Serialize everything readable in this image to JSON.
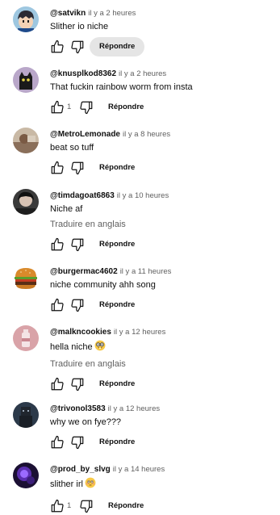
{
  "comments": [
    {
      "author": "@satvikn",
      "time": "il y a 2 heures",
      "text": "Slither io niche",
      "like_count": "",
      "reply_label": "Répondre",
      "avatar_icon": "anime-boy-avatar"
    },
    {
      "author": "@knusplkod8362",
      "time": "il y a 2 heures",
      "text": "That fuckin rainbow worm from insta",
      "like_count": "1",
      "reply_label": "Répondre",
      "avatar_icon": "black-cat-avatar"
    },
    {
      "author": "@MetroLemonade",
      "time": "il y a 8 heures",
      "text": "beat so tuff",
      "like_count": "",
      "reply_label": "Répondre",
      "avatar_icon": "photo-avatar"
    },
    {
      "author": "@timdagoat6863",
      "time": "il y a 10 heures",
      "text": "Niche af",
      "translate": "Traduire en anglais",
      "like_count": "",
      "reply_label": "Répondre",
      "avatar_icon": "dark-character-avatar"
    },
    {
      "author": "@burgermac4602",
      "time": "il y a 11 heures",
      "text": "niche community ahh song",
      "like_count": "",
      "reply_label": "Répondre",
      "avatar_icon": "burger-avatar"
    },
    {
      "author": "@malkncookies",
      "time": "il y a 12 heures",
      "text": "hella niche",
      "emoji": "nerd-face-emoji",
      "translate": "Traduire en anglais",
      "like_count": "",
      "reply_label": "Répondre",
      "avatar_icon": "bottle-avatar"
    },
    {
      "author": "@trivonol3583",
      "time": "il y a 12 heures",
      "text": "why we on fye???",
      "like_count": "",
      "reply_label": "Répondre",
      "avatar_icon": "roblox-avatar"
    },
    {
      "author": "@prod_by_slvg",
      "time": "il y a 14 heures",
      "text": "slither irl",
      "emoji": "flushed-face-emoji",
      "like_count": "1",
      "reply_label": "Répondre",
      "avatar_icon": "purple-glow-avatar"
    }
  ],
  "colors": {
    "text": "#0f0f0f",
    "secondary": "#606060",
    "reply_highlight": "#e5e5e5"
  }
}
